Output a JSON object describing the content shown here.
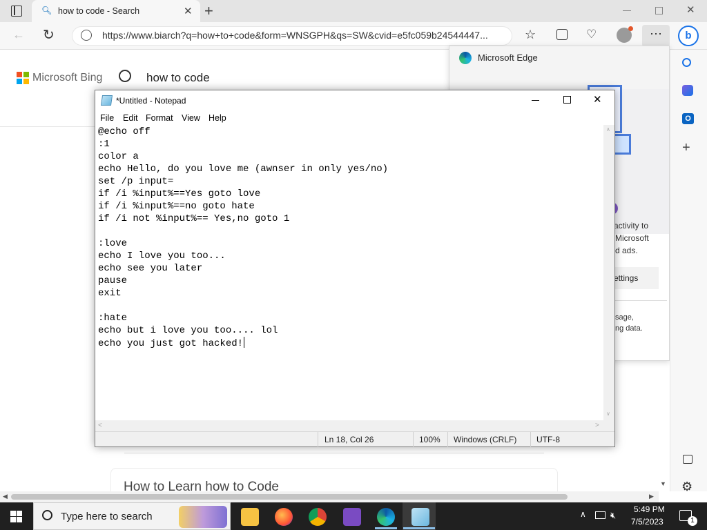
{
  "browser": {
    "tab_title": "how to code - Search",
    "url": "https://www.biarch?q=how+to+code&form=WNSGPH&qs=SW&cvid=e5fc059b24544447...",
    "bing_logo_text": "Microsoft Bing",
    "search_query": "how to code",
    "result_title": "How to Learn how to Code",
    "colors": {
      "accent": "#0067b8",
      "bing_blue": "#174ae4"
    }
  },
  "flyout": {
    "title": "Microsoft Edge",
    "text_line1": "activity to",
    "text_line2": "Microsoft",
    "text_line3": "d ads.",
    "settings_label": "ettings",
    "text_line4": "sage,",
    "text_line5": "ng data."
  },
  "notepad": {
    "title": "*Untitled - Notepad",
    "menu": [
      "File",
      "Edit",
      "Format",
      "View",
      "Help"
    ],
    "lines": [
      "@echo off",
      ":1",
      "color a",
      "echo Hello, do you love me (awnser in only yes/no)",
      "set /p input=",
      "if /i %input%==Yes goto love",
      "if /i %input%==no goto hate",
      "if /i not %input%== Yes,no goto 1",
      "",
      ":love",
      "echo I love you too...",
      "echo see you later",
      "pause",
      "exit",
      "",
      ":hate",
      "echo but i love you too.... lol",
      "echo you just got hacked!"
    ],
    "status": {
      "position": "Ln 18, Col 26",
      "zoom": "100%",
      "line_ending": "Windows (CRLF)",
      "encoding": "UTF-8"
    }
  },
  "taskbar": {
    "search_placeholder": "Type here to search",
    "time": "5:49 PM",
    "date": "7/5/2023",
    "notification_count": "1"
  }
}
